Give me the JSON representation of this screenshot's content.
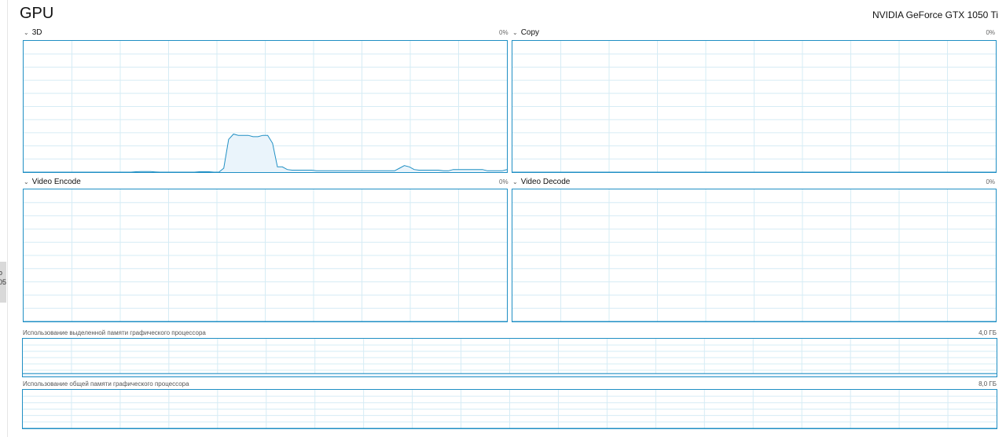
{
  "header": {
    "title": "GPU",
    "gpu_name": "NVIDIA GeForce GTX 1050 Ti"
  },
  "left_tab": {
    "text": "о\n05"
  },
  "graphs": {
    "g3d": {
      "label": "3D",
      "percent": "0%"
    },
    "copy": {
      "label": "Copy",
      "percent": "0%"
    },
    "video_encode": {
      "label": "Video Encode",
      "percent": "0%"
    },
    "video_decode": {
      "label": "Video Decode",
      "percent": "0%"
    }
  },
  "memory": {
    "dedicated": {
      "label": "Использование выделенной памяти графического процессора",
      "max": "4,0 ГБ"
    },
    "shared": {
      "label": "Использование общей памяти графического процессора",
      "max": "8,0 ГБ"
    }
  },
  "colors": {
    "accent": "#1f8fc4",
    "grid": "#d6ecf5",
    "fill": "#eaf4fb"
  },
  "chart_data": {
    "type": "area",
    "ylim": [
      0,
      100
    ],
    "series": [
      {
        "values": [
          0,
          0,
          0,
          0,
          0,
          0,
          0,
          0,
          0,
          0,
          0,
          0,
          0,
          0,
          0,
          0,
          0,
          0,
          0,
          0,
          0,
          0,
          0,
          0.3,
          0.4,
          0.4,
          0.4,
          0.2,
          0,
          0,
          0,
          0,
          0,
          0,
          0,
          0,
          0.3,
          0.3,
          0.3,
          0,
          0,
          3,
          25,
          29,
          28,
          28,
          28,
          27,
          27,
          28,
          28,
          22,
          4,
          4,
          2,
          1.5,
          1.5,
          1.5,
          1.5,
          1.5,
          1,
          1,
          1,
          1,
          1,
          1,
          1,
          1,
          1,
          1,
          1,
          1,
          1,
          1,
          1,
          1,
          1,
          3,
          5,
          4,
          2,
          1.5,
          1.5,
          1.5,
          1.5,
          1.5,
          1,
          1,
          2,
          2,
          2,
          2,
          2,
          2,
          2,
          1,
          1,
          1,
          1,
          2
        ]
      },
      {
        "values": [
          0,
          0,
          0,
          0,
          0,
          0,
          0,
          0,
          0,
          0,
          0,
          0,
          0,
          0,
          0,
          0,
          0,
          0,
          0,
          0,
          0,
          0,
          0,
          0,
          0,
          0,
          0,
          0,
          0,
          0,
          0,
          0,
          0,
          0,
          0,
          0,
          0,
          0,
          0,
          0,
          0,
          0,
          0,
          0,
          0,
          0,
          0,
          0,
          0,
          0,
          0,
          0,
          0,
          0,
          0,
          0,
          0,
          0,
          0,
          0,
          0,
          0,
          0,
          0,
          0,
          0,
          0,
          0,
          0,
          0,
          0,
          0,
          0,
          0,
          0,
          0,
          0,
          0,
          0,
          0,
          0,
          0,
          0,
          0,
          0,
          0,
          0,
          0,
          0,
          0,
          0,
          0,
          0,
          0,
          0,
          0,
          0,
          0,
          0,
          0
        ]
      },
      {
        "values": [
          0,
          0,
          0,
          0,
          0,
          0,
          0,
          0,
          0,
          0,
          0,
          0,
          0,
          0,
          0,
          0,
          0,
          0,
          0,
          0,
          0,
          0,
          0,
          0,
          0,
          0,
          0,
          0,
          0,
          0,
          0,
          0,
          0,
          0,
          0,
          0,
          0,
          0,
          0,
          0,
          0,
          0,
          0,
          0,
          0,
          0,
          0,
          0,
          0,
          0,
          0,
          0,
          0,
          0,
          0,
          0,
          0,
          0,
          0,
          0,
          0,
          0,
          0,
          0,
          0,
          0,
          0,
          0,
          0,
          0,
          0,
          0,
          0,
          0,
          0,
          0,
          0,
          0,
          0,
          0,
          0,
          0,
          0,
          0,
          0,
          0,
          0,
          0,
          0,
          0,
          0,
          0,
          0,
          0,
          0,
          0,
          0,
          0,
          0,
          0
        ]
      },
      {
        "values": [
          0,
          0,
          0,
          0,
          0,
          0,
          0,
          0,
          0,
          0,
          0,
          0,
          0,
          0,
          0,
          0,
          0,
          0,
          0,
          0,
          0,
          0,
          0,
          0,
          0,
          0,
          0,
          0,
          0,
          0,
          0,
          0,
          0,
          0,
          0,
          0,
          0,
          0,
          0,
          0,
          0,
          0,
          0,
          0,
          0,
          0,
          0,
          0,
          0,
          0,
          0,
          0,
          0,
          0,
          0,
          0,
          0,
          0,
          0,
          0,
          0,
          0,
          0,
          0,
          0,
          0,
          0,
          0,
          0,
          0,
          0,
          0,
          0,
          0,
          0,
          0,
          0,
          0,
          0,
          0,
          0,
          0,
          0,
          0,
          0,
          0,
          0,
          0,
          0,
          0,
          0,
          0,
          0,
          0,
          0,
          0,
          0,
          0,
          0,
          0
        ]
      },
      {
        "values": [
          8,
          8,
          8,
          8,
          8,
          8,
          8,
          8,
          8,
          8,
          8,
          8,
          8,
          8,
          8,
          8,
          8,
          8,
          8,
          8,
          8,
          8,
          8,
          8,
          8,
          8,
          8,
          8,
          8,
          8,
          8,
          8,
          8,
          8,
          8,
          8,
          8,
          8,
          8,
          8,
          8,
          8,
          8,
          8,
          8,
          8,
          8,
          8,
          8,
          8,
          8,
          8,
          8,
          8,
          8,
          8,
          8,
          8,
          8,
          8,
          8,
          8,
          8,
          8,
          8,
          8,
          8,
          8,
          8,
          8,
          8,
          8,
          8,
          8,
          8,
          8,
          8,
          8,
          8,
          8,
          8,
          8,
          8,
          8,
          8,
          8,
          8,
          8,
          8,
          8,
          8,
          8,
          8,
          8,
          8,
          8,
          8,
          8,
          8,
          8
        ]
      },
      {
        "values": [
          0,
          0,
          0,
          0,
          0,
          0,
          0,
          0,
          0,
          0,
          0,
          0,
          0,
          0,
          0,
          0,
          0,
          0,
          0,
          0,
          0,
          0,
          0,
          0,
          0,
          0,
          0,
          0,
          0,
          0,
          0,
          0,
          0,
          0,
          0,
          0,
          0,
          0,
          0,
          0,
          0,
          0,
          0,
          0,
          0,
          0,
          0,
          0,
          0,
          0,
          0,
          0,
          0,
          0,
          0,
          0,
          0,
          0,
          0,
          0,
          0,
          0,
          0,
          0,
          0,
          0,
          0,
          0,
          0,
          0,
          0,
          0,
          0,
          0,
          0,
          0,
          0,
          0,
          0,
          0,
          0,
          0,
          0,
          0,
          0,
          0,
          0,
          0,
          0,
          0,
          0,
          0,
          0,
          0,
          0,
          0,
          0,
          0,
          0,
          0
        ]
      }
    ]
  }
}
